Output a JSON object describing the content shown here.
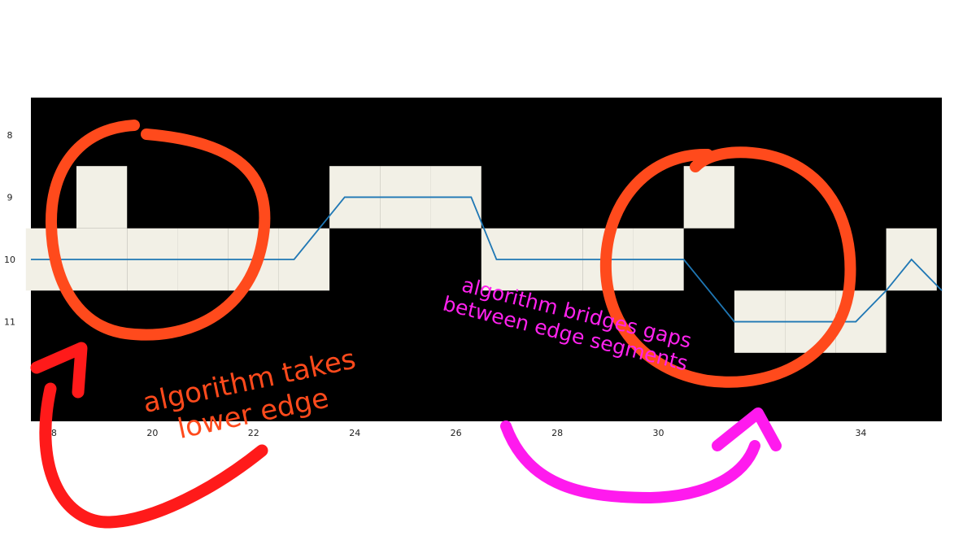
{
  "chart_data": {
    "type": "heatmap",
    "xlim": [
      17.6,
      35.6
    ],
    "ylim": [
      12.6,
      7.4
    ],
    "x_ticks": [
      18,
      20,
      22,
      24,
      26,
      28,
      30,
      34
    ],
    "y_ticks": [
      8,
      9,
      10,
      11
    ],
    "tick_labels": {
      "x": [
        "18",
        "20",
        "22",
        "24",
        "26",
        "28",
        "30",
        "34"
      ],
      "y": [
        "8",
        "9",
        "10",
        "11"
      ]
    },
    "background_color": "#000000",
    "pixel_color": "#f2f0e6",
    "edge_pixels": [
      {
        "x": 18,
        "y": 10
      },
      {
        "x": 19,
        "y": 10
      },
      {
        "x": 19,
        "y": 9
      },
      {
        "x": 20,
        "y": 10
      },
      {
        "x": 21,
        "y": 10
      },
      {
        "x": 22,
        "y": 10
      },
      {
        "x": 23,
        "y": 10
      },
      {
        "x": 24,
        "y": 9
      },
      {
        "x": 25,
        "y": 9
      },
      {
        "x": 26,
        "y": 9
      },
      {
        "x": 27,
        "y": 10
      },
      {
        "x": 28,
        "y": 10
      },
      {
        "x": 29,
        "y": 10
      },
      {
        "x": 30,
        "y": 10
      },
      {
        "x": 31,
        "y": 9
      },
      {
        "x": 32,
        "y": 11
      },
      {
        "x": 33,
        "y": 11
      },
      {
        "x": 34,
        "y": 11
      },
      {
        "x": 35,
        "y": 10
      }
    ],
    "series": [
      {
        "color": "#1f77b4",
        "x": [
          17.6,
          17.8,
          18,
          19,
          20,
          21,
          22,
          22.8,
          23.3,
          23.8,
          24,
          25,
          26,
          26.3,
          26.8,
          27,
          28,
          29,
          30,
          30.5,
          31,
          31.5,
          32,
          33,
          33.9,
          34.5,
          35,
          35.6
        ],
        "y": [
          10,
          10,
          10,
          10,
          10,
          10,
          10,
          10,
          9.5,
          9,
          9,
          9,
          9,
          9,
          10,
          10,
          10,
          10,
          10,
          10,
          10.5,
          11,
          11,
          11,
          11,
          10.5,
          10,
          10.5
        ]
      }
    ],
    "annotations": [
      {
        "text_lines": [
          "algorithm takes",
          "lower edge"
        ],
        "color": "#ff4a1c"
      },
      {
        "text_lines": [
          "algorithm bridges gaps",
          "between edge segments"
        ],
        "color": "#ff22ee"
      }
    ],
    "circle_color": "#ff4a1c",
    "left_arrow_color": "#ff1a1a",
    "right_arrow_color": "#ff1aee"
  }
}
